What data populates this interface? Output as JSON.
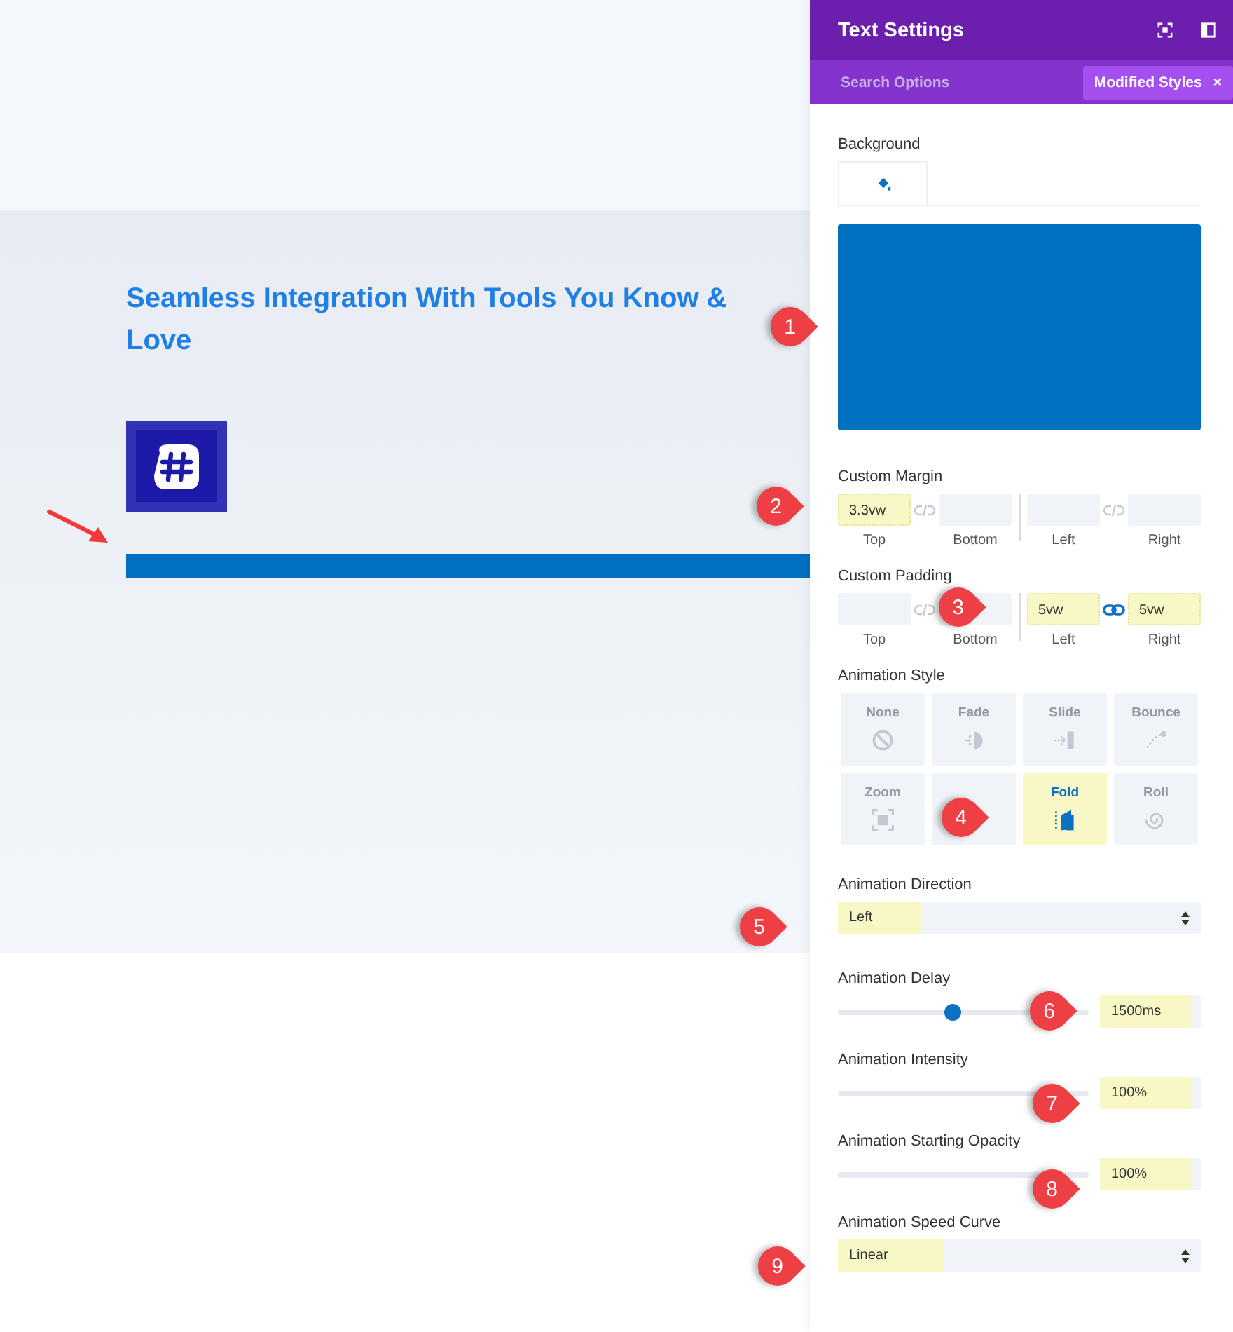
{
  "page": {
    "heading": "Seamless Integration With Tools You Know & Love"
  },
  "panel": {
    "title": "Text Settings",
    "tabs": [
      {
        "label": "Search Options",
        "selected": false
      },
      {
        "label": "Modified Styles",
        "selected": true,
        "close": "×"
      }
    ],
    "background": {
      "label": "Background"
    },
    "margin": {
      "label": "Custom Margin",
      "fields": [
        {
          "label": "Top",
          "value": "3.3vw",
          "modified": true
        },
        {
          "label": "Bottom",
          "modified": false
        },
        {
          "label": "Left",
          "modified": false
        },
        {
          "label": "Right",
          "modified": false
        }
      ],
      "links": [
        {
          "linked": false
        },
        {
          "linked": false
        }
      ]
    },
    "padding": {
      "label": "Custom Padding",
      "fields": [
        {
          "label": "Top",
          "modified": false
        },
        {
          "label": "Bottom",
          "modified": false
        },
        {
          "label": "Left",
          "value": "5vw",
          "modified": true
        },
        {
          "label": "Right",
          "value": "5vw",
          "modified": true
        }
      ],
      "links": [
        {
          "linked": false
        },
        {
          "linked": true
        }
      ]
    },
    "animation_style": {
      "label": "Animation Style",
      "options": [
        {
          "label": "None",
          "selected": false
        },
        {
          "label": "Fade",
          "selected": false
        },
        {
          "label": "Slide",
          "selected": false
        },
        {
          "label": "Bounce",
          "selected": false
        },
        {
          "label": "Zoom",
          "selected": false
        },
        {
          "selected": false
        },
        {
          "label": "Fold",
          "selected": true
        },
        {
          "label": "Roll",
          "selected": false
        }
      ]
    },
    "direction": {
      "label": "Animation Direction",
      "value": "Left",
      "modified": true
    },
    "sliders": [
      {
        "label": "Animation Delay",
        "level": 0.46,
        "value": "1500ms",
        "modified": true
      },
      {
        "label": "Animation Intensity",
        "value": "100%",
        "modified": true
      },
      {
        "label": "Animation Starting Opacity",
        "value": "100%",
        "modified": true
      }
    ],
    "speed_curve": {
      "label": "Animation Speed Curve",
      "value": "Linear",
      "modified": true
    }
  },
  "callouts": [
    {
      "number": "1"
    },
    {
      "number": "2"
    },
    {
      "number": "3"
    },
    {
      "number": "4"
    },
    {
      "number": "5"
    },
    {
      "number": "6"
    },
    {
      "number": "7"
    },
    {
      "number": "8"
    },
    {
      "number": "9"
    }
  ]
}
